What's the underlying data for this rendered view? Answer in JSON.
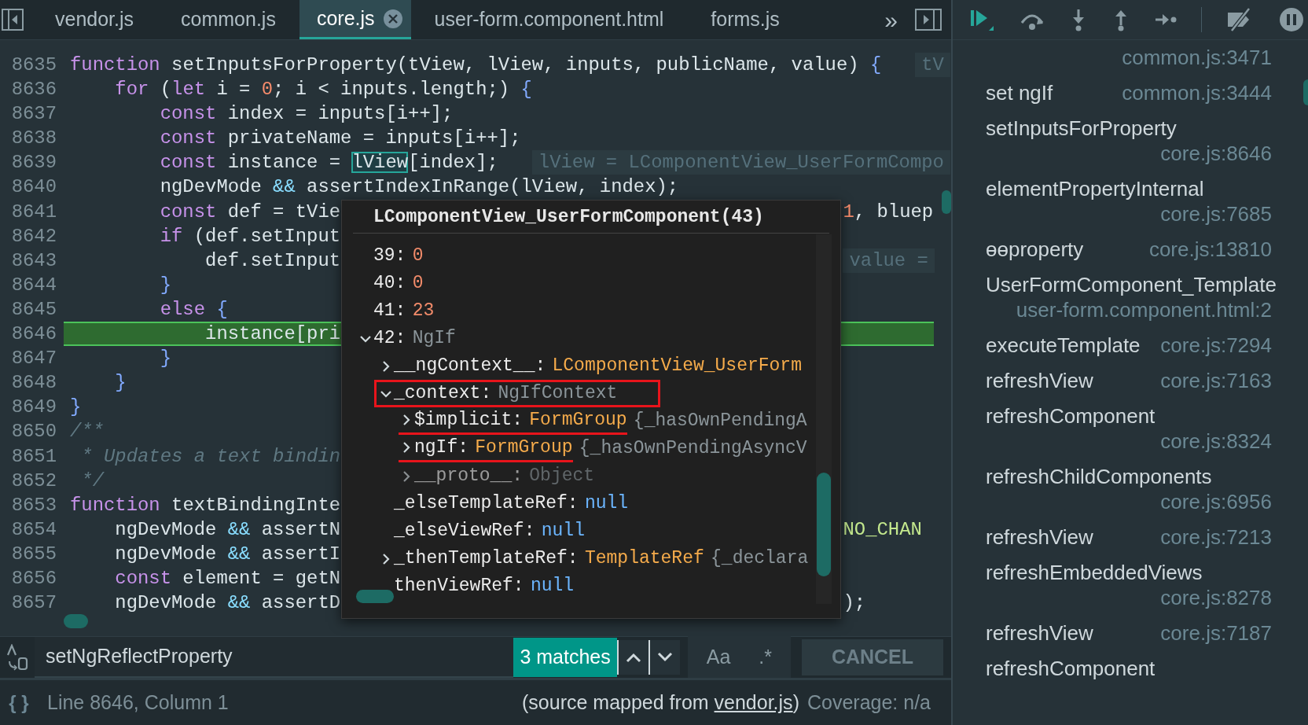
{
  "tabs": [
    {
      "label": "vendor.js",
      "selected": false
    },
    {
      "label": "common.js",
      "selected": false
    },
    {
      "label": "core.js",
      "selected": true,
      "closable": true
    },
    {
      "label": "user-form.component.html",
      "selected": false
    },
    {
      "label": "forms.js",
      "selected": false
    }
  ],
  "tab_overflow": "»",
  "editor": {
    "lines": [
      {
        "number": "8635",
        "current": false,
        "code": [
          {
            "kind": "kw",
            "text": "function"
          },
          {
            "kind": "id",
            "text": " setInputsForProperty(tView, lView, inputs, publicName, value) "
          },
          {
            "kind": "br",
            "text": "{"
          }
        ],
        "hint": "tV"
      },
      {
        "number": "8636",
        "current": false,
        "code": [
          {
            "kind": "kw",
            "text": "    for"
          },
          {
            "kind": "id",
            "text": " ("
          },
          {
            "kind": "kw",
            "text": "let"
          },
          {
            "kind": "id",
            "text": " i = "
          },
          {
            "kind": "num",
            "text": "0"
          },
          {
            "kind": "id",
            "text": "; i < inputs.length;) "
          },
          {
            "kind": "br",
            "text": "{"
          }
        ]
      },
      {
        "number": "8637",
        "current": false,
        "code": [
          {
            "kind": "kw",
            "text": "        const"
          },
          {
            "kind": "id",
            "text": " index = inputs[i++];"
          }
        ]
      },
      {
        "number": "8638",
        "current": false,
        "code": [
          {
            "kind": "kw",
            "text": "        const"
          },
          {
            "kind": "id",
            "text": " privateName = inputs[i++];"
          }
        ]
      },
      {
        "number": "8639",
        "current": false,
        "code": [
          {
            "kind": "kw",
            "text": "        const"
          },
          {
            "kind": "id",
            "text": " instance = "
          },
          {
            "kind": "sel",
            "text": "lView"
          },
          {
            "kind": "id",
            "text": "[index];"
          }
        ],
        "hint": "lView = LComponentView_UserFormCompo"
      },
      {
        "number": "8640",
        "current": false,
        "code": [
          {
            "kind": "id",
            "text": "        ngDevMode "
          },
          {
            "kind": "op",
            "text": "&&"
          },
          {
            "kind": "id",
            "text": " assertIndexInRange(lView, index);"
          }
        ]
      },
      {
        "number": "8641",
        "current": false,
        "code": [
          {
            "kind": "kw",
            "text": "        const"
          },
          {
            "kind": "id",
            "text": " def = tVie"
          }
        ],
        "tail": [
          {
            "kind": "num",
            "text": "1"
          },
          {
            "kind": "id",
            "text": ", bluep"
          }
        ]
      },
      {
        "number": "8642",
        "current": false,
        "code": [
          {
            "kind": "kw",
            "text": "        if"
          },
          {
            "kind": "id",
            "text": " (def.setInput"
          }
        ]
      },
      {
        "number": "8643",
        "current": false,
        "code": [
          {
            "kind": "id",
            "text": "            def.setInput"
          }
        ],
        "tail_hint": "value ="
      },
      {
        "number": "8644",
        "current": false,
        "code": [
          {
            "kind": "br",
            "text": "        }"
          }
        ]
      },
      {
        "number": "8645",
        "current": false,
        "code": [
          {
            "kind": "kw",
            "text": "        else"
          },
          {
            "kind": "br",
            "text": " {"
          }
        ]
      },
      {
        "number": "8646",
        "current": true,
        "code": [
          {
            "kind": "id",
            "text": "            instance[pri"
          }
        ]
      },
      {
        "number": "8647",
        "current": false,
        "code": [
          {
            "kind": "br",
            "text": "        }"
          }
        ]
      },
      {
        "number": "8648",
        "current": false,
        "code": [
          {
            "kind": "br",
            "text": "    }"
          }
        ]
      },
      {
        "number": "8649",
        "current": false,
        "code": [
          {
            "kind": "br",
            "text": "}"
          }
        ]
      },
      {
        "number": "8650",
        "current": false,
        "code": [
          {
            "kind": "cm",
            "text": "/**"
          }
        ]
      },
      {
        "number": "8651",
        "current": false,
        "code": [
          {
            "kind": "cm",
            "text": " * Updates a text bindin"
          }
        ]
      },
      {
        "number": "8652",
        "current": false,
        "code": [
          {
            "kind": "cm",
            "text": " */"
          }
        ]
      },
      {
        "number": "8653",
        "current": false,
        "code": [
          {
            "kind": "kw",
            "text": "function"
          },
          {
            "kind": "id",
            "text": " textBindingInte"
          }
        ]
      },
      {
        "number": "8654",
        "current": false,
        "code": [
          {
            "kind": "id",
            "text": "    ngDevMode "
          },
          {
            "kind": "op",
            "text": "&&"
          },
          {
            "kind": "id",
            "text": " assertN"
          }
        ],
        "tail": [
          {
            "kind": "const",
            "text": "NO_CHAN"
          }
        ]
      },
      {
        "number": "8655",
        "current": false,
        "code": [
          {
            "kind": "id",
            "text": "    ngDevMode "
          },
          {
            "kind": "op",
            "text": "&&"
          },
          {
            "kind": "id",
            "text": " assertI"
          }
        ]
      },
      {
        "number": "8656",
        "current": false,
        "code": [
          {
            "kind": "kw",
            "text": "    const"
          },
          {
            "kind": "id",
            "text": " element = getN"
          }
        ]
      },
      {
        "number": "8657",
        "current": false,
        "code": [
          {
            "kind": "id",
            "text": "    ngDevMode "
          },
          {
            "kind": "op",
            "text": "&&"
          },
          {
            "kind": "id",
            "text": " assertD"
          }
        ],
        "tail": [
          {
            "kind": "id",
            "text": ");"
          }
        ]
      }
    ]
  },
  "popup": {
    "title": "LComponentView_UserFormComponent(43)",
    "rows": [
      {
        "key": "39:",
        "value": "0",
        "kind": "num"
      },
      {
        "key": "40:",
        "value": "0",
        "kind": "num"
      },
      {
        "key": "41:",
        "value": "23",
        "kind": "num"
      },
      {
        "key": "42:",
        "value": "NgIf",
        "kind": "dim",
        "expanded": true,
        "children": [
          {
            "key": "__ngContext__:",
            "value": "LComponentView_UserForm",
            "kind": "obj",
            "expanded": false,
            "boxed": false
          },
          {
            "key": "_context:",
            "value": "NgIfContext",
            "kind": "dim",
            "expanded": true,
            "boxed": true,
            "children": [
              {
                "key": "$implicit:",
                "value": "FormGroup",
                "preview": "{_hasOwnPendingA",
                "kind": "obj",
                "expanded": false,
                "underlined": true,
                "faded": false
              },
              {
                "key": "ngIf:",
                "value": "FormGroup",
                "preview": "{_hasOwnPendingAsyncV",
                "kind": "obj",
                "expanded": false,
                "underlined": true,
                "faded": false
              },
              {
                "key": "__proto__:",
                "value": "Object",
                "kind": "dim",
                "expanded": false,
                "underlined": false,
                "faded": true
              }
            ]
          },
          {
            "key": "_elseTemplateRef:",
            "value": "null",
            "kind": "null",
            "boxed": false
          },
          {
            "key": "_elseViewRef:",
            "value": "null",
            "kind": "null",
            "boxed": false
          },
          {
            "key": "_thenTemplateRef:",
            "value": "TemplateRef",
            "preview": "{_declara",
            "kind": "obj",
            "expanded": false,
            "boxed": false
          },
          {
            "key": "thenViewRef:",
            "value": "null",
            "kind": "null",
            "boxed": false
          }
        ]
      }
    ]
  },
  "search": {
    "value": "setNgReflectProperty",
    "matches": "3 matches",
    "case_label": "Aa",
    "regex_label": ".*",
    "cancel": "CANCEL"
  },
  "status": {
    "format_button": "{ }",
    "position": "Line 8646, Column 1",
    "source_prefix": "(source mapped from",
    "source_link": "vendor.js",
    "source_suffix": ")",
    "coverage": "Coverage: n/a"
  },
  "call_stack": [
    {
      "location": "common.js:3471"
    },
    {
      "name": "set ngIf",
      "location": "common.js:3444"
    },
    {
      "name": "setInputsForProperty",
      "location": "core.js:8646"
    },
    {
      "name": "elementPropertyInternal",
      "location": "core.js:7685"
    },
    {
      "name": "ɵɵproperty",
      "location": "core.js:13810"
    },
    {
      "name": "UserFormComponent_Template",
      "location": "user-form.component.html:2"
    },
    {
      "name": "executeTemplate",
      "location": "core.js:7294"
    },
    {
      "name": "refreshView",
      "location": "core.js:7163"
    },
    {
      "name": "refreshComponent",
      "location": "core.js:8324"
    },
    {
      "name": "refreshChildComponents",
      "location": "core.js:6956"
    },
    {
      "name": "refreshView",
      "location": "core.js:7213"
    },
    {
      "name": "refreshEmbeddedViews",
      "location": "core.js:8278"
    },
    {
      "name": "refreshView",
      "location": "core.js:7187"
    },
    {
      "name": "refreshComponent"
    }
  ]
}
